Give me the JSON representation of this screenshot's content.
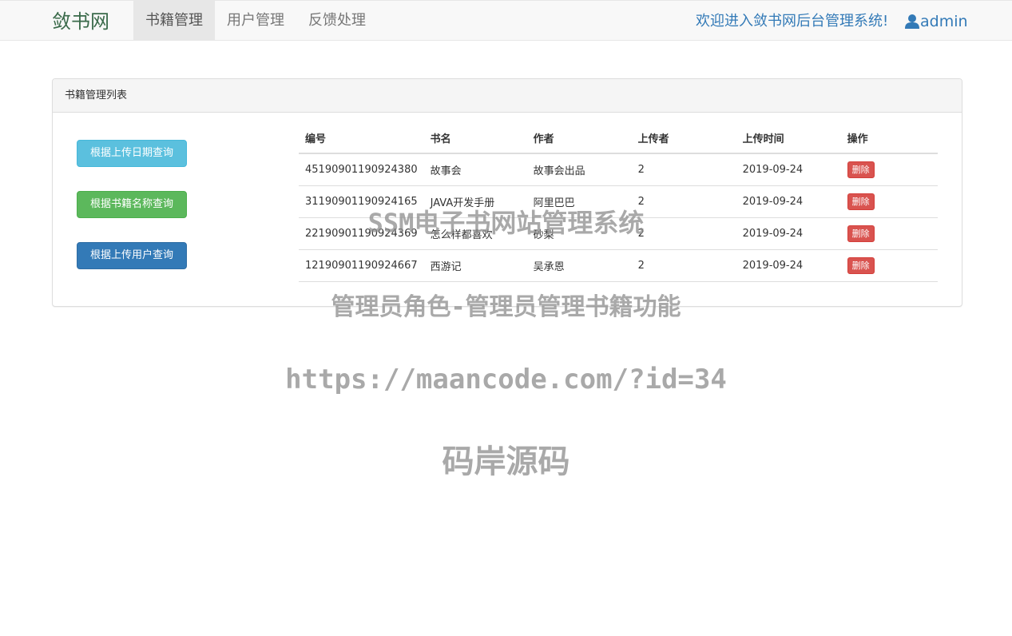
{
  "navbar": {
    "brand": "敛书网",
    "items": [
      {
        "label": "书籍管理",
        "active": true
      },
      {
        "label": "用户管理",
        "active": false
      },
      {
        "label": "反馈处理",
        "active": false
      }
    ],
    "welcome": "欢迎进入敛书网后台管理系统!",
    "user_icon": "user-icon",
    "username": "admin"
  },
  "panel": {
    "title": "书籍管理列表",
    "buttons": {
      "by_date": "根据上传日期查询",
      "by_name": "根据书籍名称查询",
      "by_user": "根据上传用户查询"
    }
  },
  "table": {
    "headers": {
      "id": "编号",
      "name": "书名",
      "author": "作者",
      "uploader": "上传者",
      "time": "上传时间",
      "action": "操作"
    },
    "rows": [
      {
        "id": "45190901190924380",
        "name": "故事会",
        "author": "故事会出品",
        "uploader": "2",
        "time": "2019-09-24",
        "action": "删除"
      },
      {
        "id": "31190901190924165",
        "name": "JAVA开发手册",
        "author": "阿里巴巴",
        "uploader": "2",
        "time": "2019-09-24",
        "action": "删除"
      },
      {
        "id": "22190901190924369",
        "name": "怎么样都喜欢",
        "author": "砂梨",
        "uploader": "2",
        "time": "2019-09-24",
        "action": "删除"
      },
      {
        "id": "12190901190924667",
        "name": "西游记",
        "author": "吴承恩",
        "uploader": "2",
        "time": "2019-09-24",
        "action": "删除"
      }
    ]
  },
  "watermarks": {
    "line1": "SSM电子书网站管理系统",
    "line2": "管理员角色-管理员管理书籍功能",
    "line3": "https://maancode.com/?id=34",
    "line4": "码岸源码"
  },
  "colors": {
    "link": "#337ab7",
    "info": "#5bc0de",
    "success": "#5cb85c",
    "primary": "#337ab7",
    "danger": "#d9534f"
  }
}
